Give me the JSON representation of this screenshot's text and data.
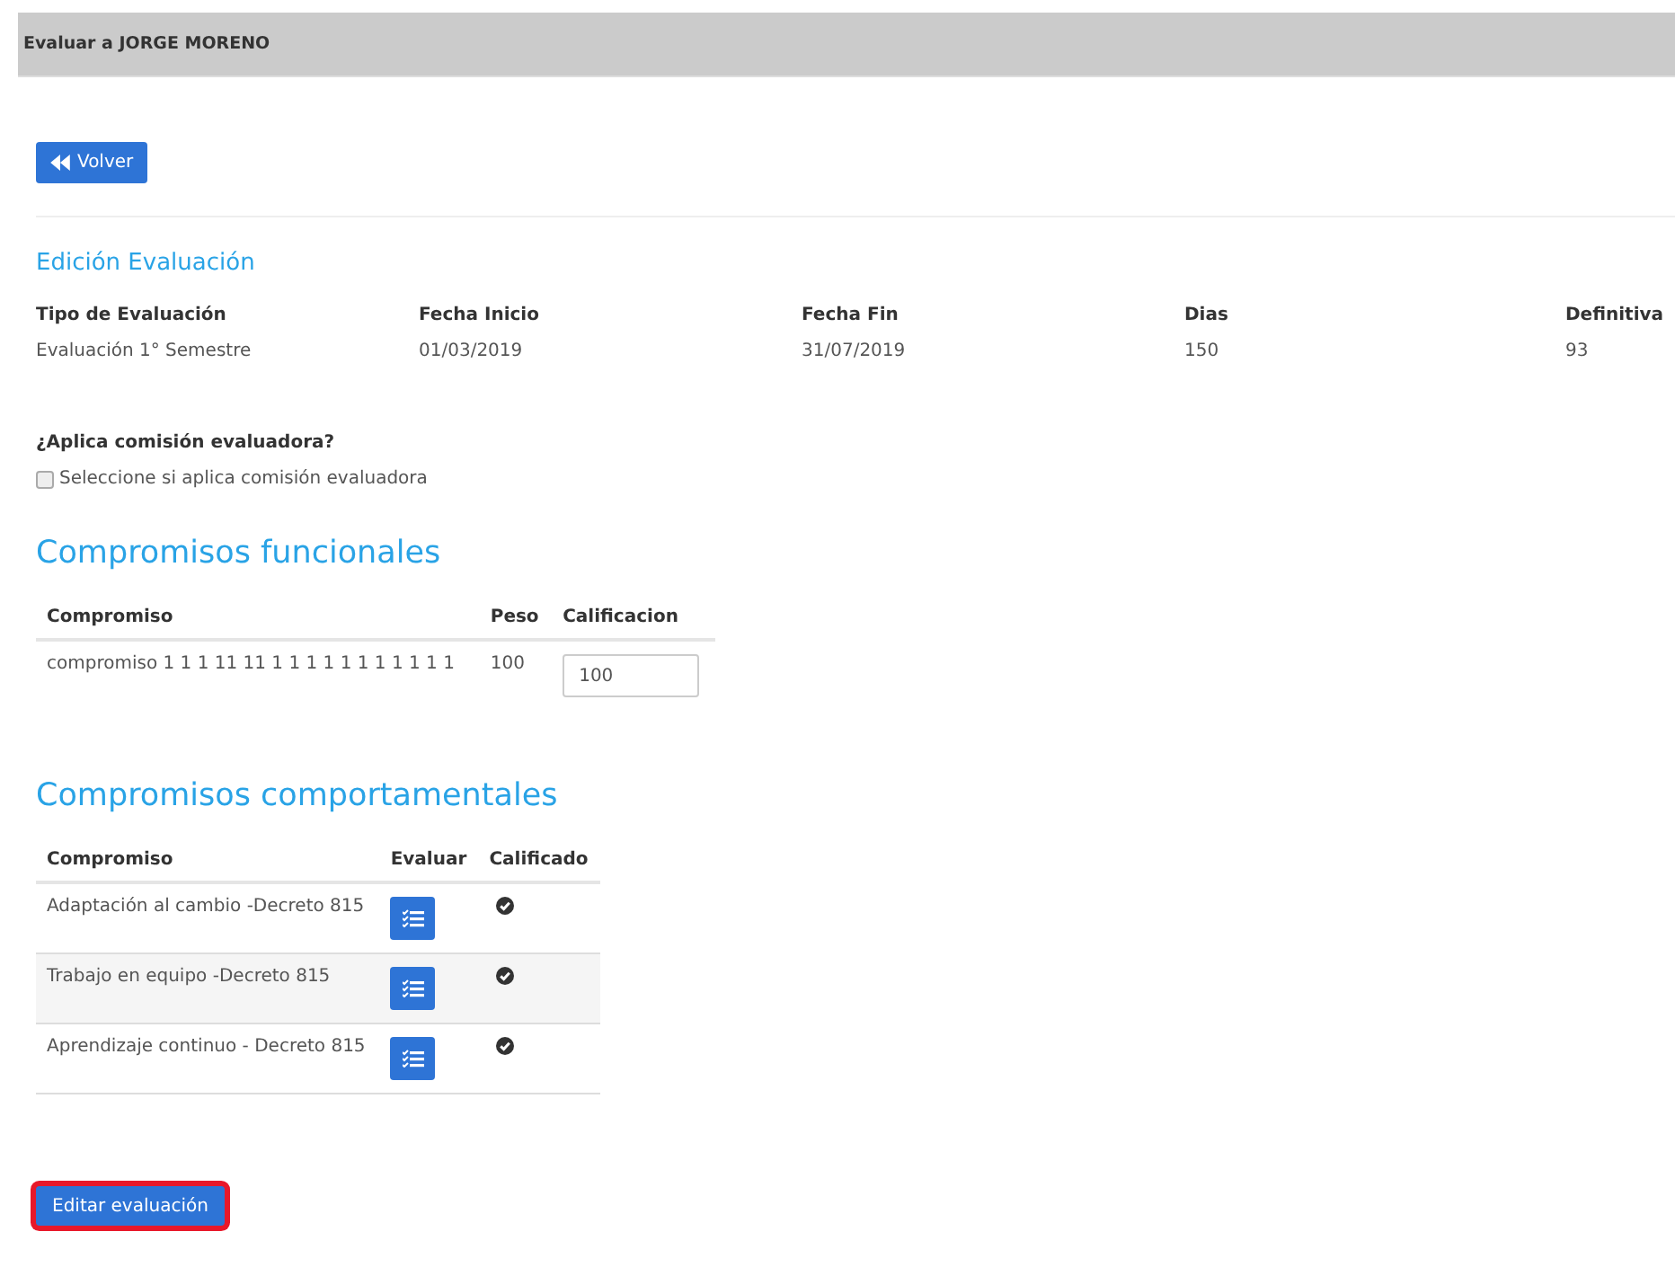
{
  "header": {
    "title": "Evaluar a JORGE MORENO"
  },
  "back_button": {
    "label": "Volver"
  },
  "edit_section": {
    "title": "Edición Evaluación",
    "fields": [
      {
        "label": "Tipo de Evaluación",
        "value": "Evaluación 1° Semestre"
      },
      {
        "label": "Fecha Inicio",
        "value": "01/03/2019"
      },
      {
        "label": "Fecha Fin",
        "value": "31/07/2019"
      },
      {
        "label": "Dias",
        "value": "150"
      },
      {
        "label": "Definitiva",
        "value": "93"
      }
    ]
  },
  "commission": {
    "question": "¿Aplica comisión evaluadora?",
    "checkbox_label": "Seleccione si aplica comisión evaluadora",
    "checked": false
  },
  "functional": {
    "title": "Compromisos funcionales",
    "columns": [
      "Compromiso",
      "Peso",
      "Calificacion"
    ],
    "rows": [
      {
        "compromiso": "compromiso 1 1 1 11 11 1 1 1 1 1 1 1 1 1 1 1",
        "peso": "100",
        "calificacion": "100"
      }
    ]
  },
  "behavioral": {
    "title": "Compromisos comportamentales",
    "columns": [
      "Compromiso",
      "Evaluar",
      "Calificado"
    ],
    "rows": [
      {
        "compromiso": "Adaptación al cambio -Decreto 815",
        "calificado": true
      },
      {
        "compromiso": "Trabajo en equipo -Decreto 815",
        "calificado": true
      },
      {
        "compromiso": "Aprendizaje continuo - Decreto 815",
        "calificado": true
      }
    ]
  },
  "edit_button": {
    "label": "Editar evaluación",
    "highlighted": true
  }
}
